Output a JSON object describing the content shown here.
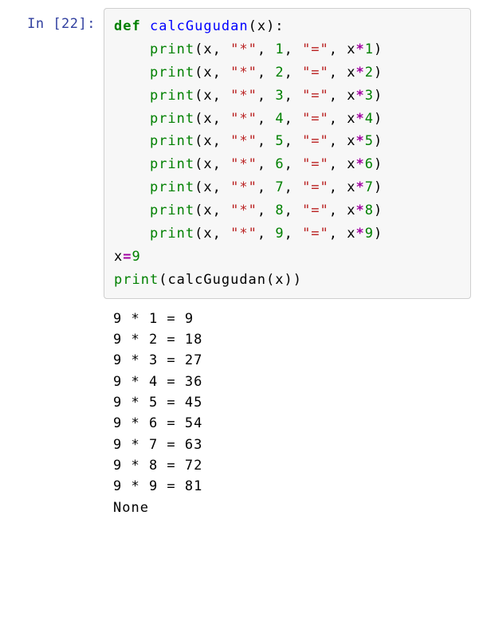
{
  "prompt": {
    "label": "In [22]:"
  },
  "code": {
    "def_kw": "def",
    "func_name": "calcGugudan",
    "param": "x",
    "call_print": "print",
    "star_str": "\"*\"",
    "eq_str": "\"=\"",
    "nums": {
      "n1": "1",
      "n2": "2",
      "n3": "3",
      "n4": "4",
      "n5": "5",
      "n6": "6",
      "n7": "7",
      "n8": "8",
      "n9": "9"
    },
    "assign_line_var": "x",
    "assign_line_val": "9",
    "last_call_outer": "print",
    "last_call_inner": "calcGugudan",
    "last_call_arg": "x"
  },
  "output": {
    "l1": "9 * 1 = 9",
    "l2": "9 * 2 = 18",
    "l3": "9 * 3 = 27",
    "l4": "9 * 4 = 36",
    "l5": "9 * 5 = 45",
    "l6": "9 * 6 = 54",
    "l7": "9 * 7 = 63",
    "l8": "9 * 8 = 72",
    "l9": "9 * 9 = 81",
    "l10": "None"
  }
}
